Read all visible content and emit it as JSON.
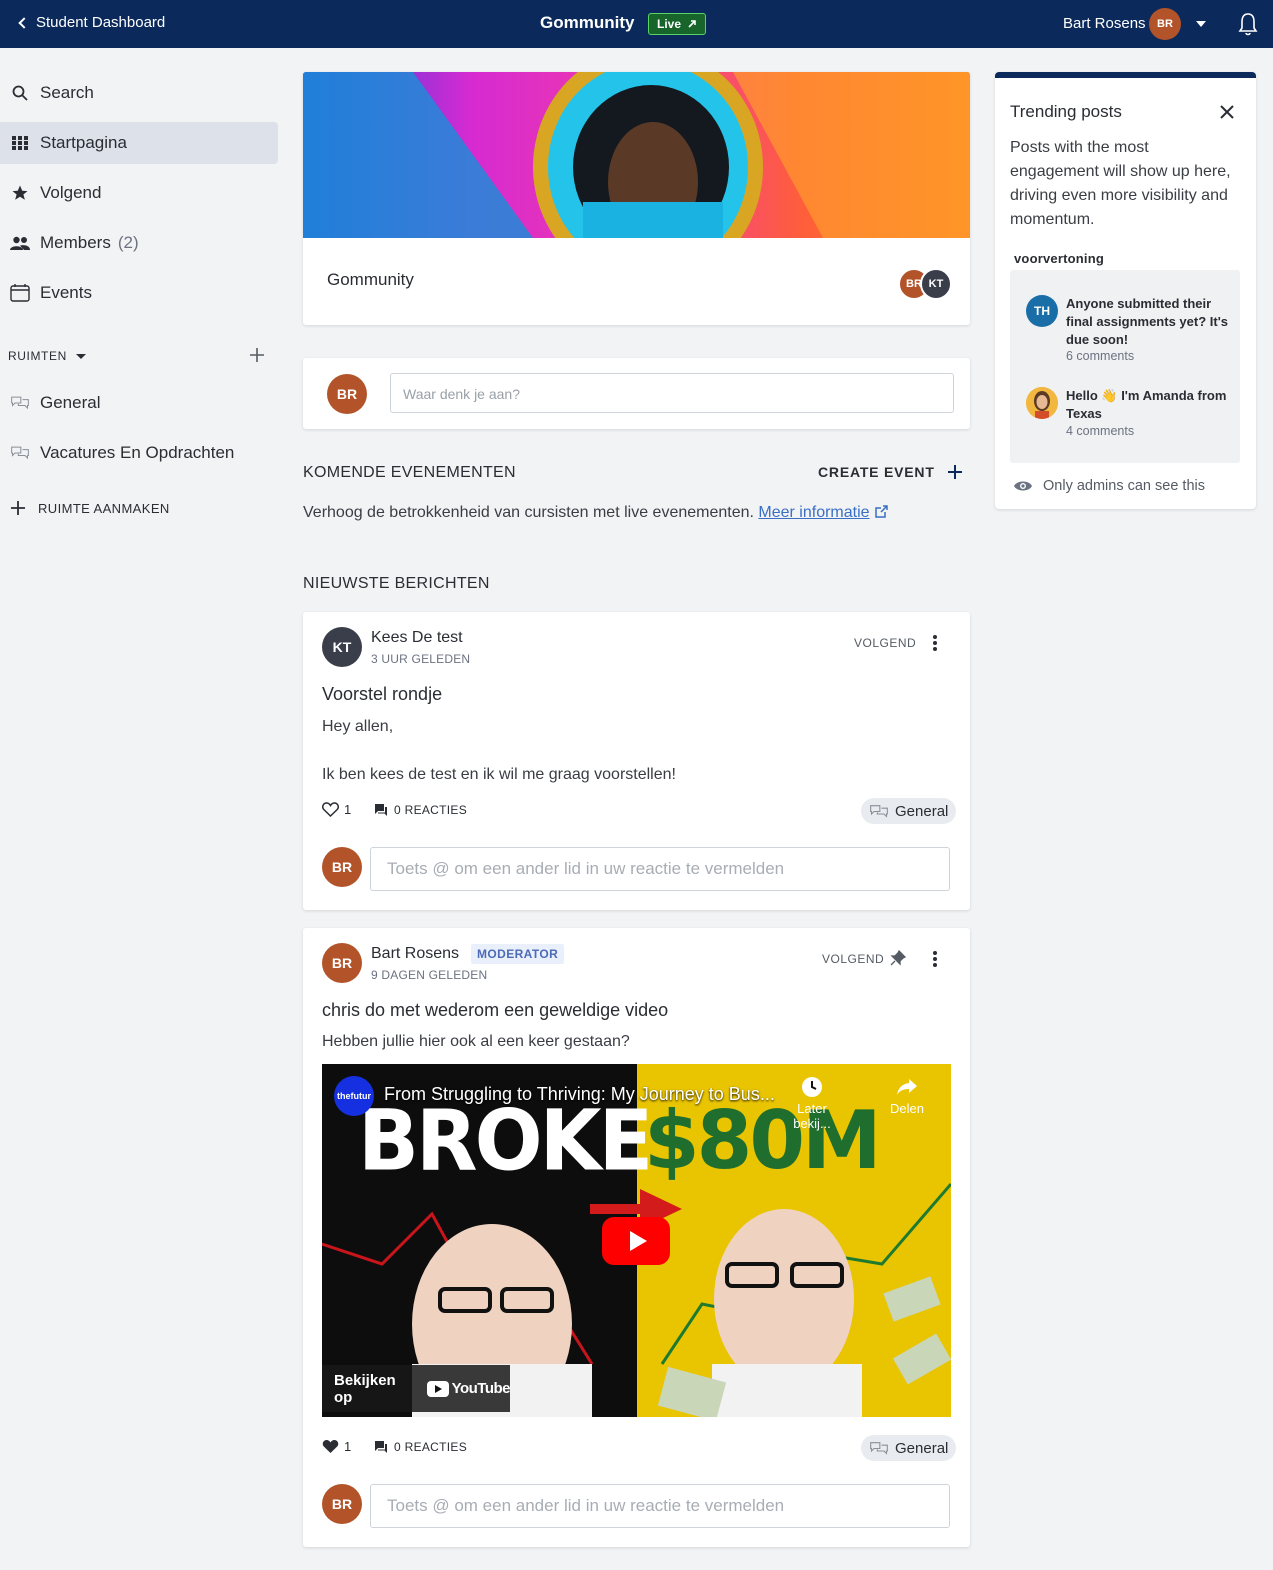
{
  "topbar": {
    "back_label": "Student Dashboard",
    "title": "Gommunity",
    "live_badge": "Live",
    "user_name": "Bart Rosens",
    "user_initials": "BR"
  },
  "sidebar": {
    "items": [
      {
        "label": "Search",
        "icon": "search-icon"
      },
      {
        "label": "Startpagina",
        "icon": "grid-icon",
        "active": true
      },
      {
        "label": "Volgend",
        "icon": "star-icon"
      },
      {
        "label": "Members",
        "count": "(2)",
        "icon": "people-icon"
      },
      {
        "label": "Events",
        "icon": "calendar-icon"
      }
    ],
    "spaces_label": "RUIMTEN",
    "spaces": [
      {
        "label": "General",
        "icon": "chat-bubbles-icon"
      },
      {
        "label": "Vacatures En Opdrachten",
        "icon": "chat-bubbles-icon"
      }
    ],
    "create_space_label": "RUIMTE AANMAKEN"
  },
  "hero": {
    "title": "Gommunity",
    "avatars": [
      "BR",
      "KT"
    ]
  },
  "composer": {
    "avatar": "BR",
    "placeholder": "Waar denk je aan?"
  },
  "events": {
    "heading": "KOMENDE EVENEMENTEN",
    "create_label": "CREATE EVENT",
    "description": "Verhoog de betrokkenheid van cursisten met live evenementen.",
    "more_link": "Meer informatie"
  },
  "latest": {
    "heading": "NIEUWSTE BERICHTEN"
  },
  "posts": [
    {
      "avatar": "KT",
      "author": "Kees De test",
      "time": "3 UUR GELEDEN",
      "follow": "VOLGEND",
      "title": "Voorstel rondje",
      "body_line1": "Hey allen,",
      "body_line2": "Ik ben kees de test en ik wil me graag voorstellen!",
      "likes": "1",
      "comments": "0 REACTIES",
      "space": "General",
      "reply_placeholder": "Toets @ om een ander lid in uw reactie te vermelden",
      "reply_avatar": "BR"
    },
    {
      "avatar": "BR",
      "author": "Bart Rosens",
      "role": "MODERATOR",
      "time": "9 DAGEN GELEDEN",
      "follow": "VOLGEND",
      "title": "chris do met wederom een geweldige video",
      "body_line1": "Hebben jullie hier ook al een keer gestaan?",
      "video": {
        "title": "From Struggling to Thriving: My Journey to Bus...",
        "channel": "thefutur",
        "later": "Later bekij...",
        "share": "Delen",
        "left_text": "BROKE",
        "right_text": "$80M",
        "watch_on": "Bekijken op",
        "youtube": "YouTube"
      },
      "likes": "1",
      "comments": "0 REACTIES",
      "space": "General",
      "reply_placeholder": "Toets @ om een ander lid in uw reactie te vermelden",
      "reply_avatar": "BR"
    }
  ],
  "trending": {
    "title": "Trending posts",
    "description": "Posts with the most engagement will show up here, driving even more visibility and momentum.",
    "preview_label": "voorvertoning",
    "items": [
      {
        "avatar": "TH",
        "text": "Anyone submitted their final assignments yet? It's due soon!",
        "comments": "6 comments"
      },
      {
        "avatar": "",
        "text": "Hello 👋 I'm Amanda from Texas",
        "comments": "4 comments"
      }
    ],
    "admins_note": "Only admins can see this"
  },
  "colors": {
    "topbar": "#0b2a5b",
    "avatar_br": "#b2532a",
    "avatar_kt": "#3a3d4a",
    "live_badge": "#17652a",
    "link": "#3a6fc4"
  }
}
